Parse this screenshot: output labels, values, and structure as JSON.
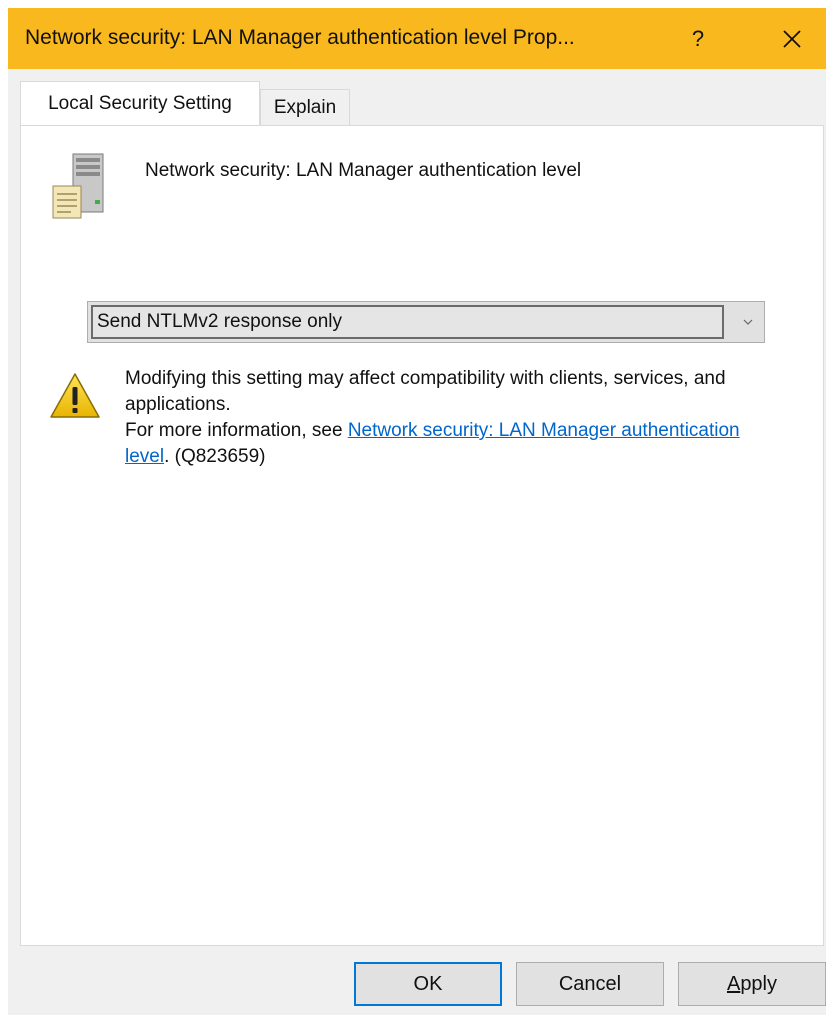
{
  "window": {
    "title": "Network security: LAN Manager authentication level Prop...",
    "help_label": "?",
    "titlebar_color": "#f9b81d"
  },
  "tabs": [
    {
      "label": "Local Security Setting",
      "active": true
    },
    {
      "label": "Explain",
      "active": false
    }
  ],
  "policy": {
    "name": "Network security: LAN Manager authentication level",
    "icon": "server-icon"
  },
  "dropdown": {
    "selected": "Send NTLMv2 response only"
  },
  "warning": {
    "icon": "warning-icon",
    "line1": "Modifying this setting may affect compatibility with clients, services, and applications.",
    "more_info_prefix": "For more information, see ",
    "link_text": "Network security: LAN Manager authentication level",
    "suffix": ". (Q823659)",
    "link_color": "#0066cc"
  },
  "buttons": {
    "ok": "OK",
    "cancel": "Cancel",
    "apply_first": "A",
    "apply_rest": "pply"
  }
}
